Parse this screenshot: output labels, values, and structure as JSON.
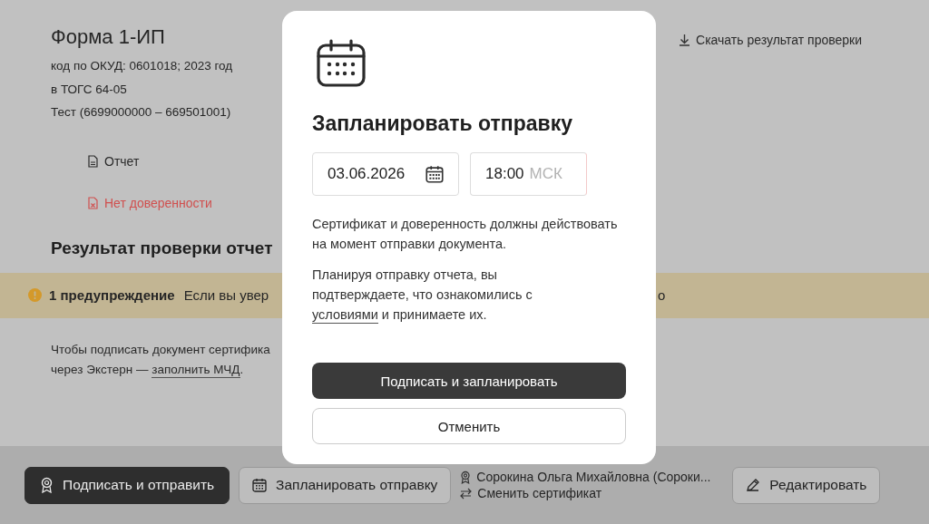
{
  "form": {
    "title": "Форма 1-ИП",
    "details": [
      "код по ОКУД: 0601018; 2023 год",
      "в ТОГС 64-05",
      "Тест (6699000000 – 669501001)"
    ]
  },
  "download_link": "Скачать результат проверки",
  "documents": [
    {
      "label": "Отчет",
      "error": false
    },
    {
      "label": "Нет доверенности",
      "error": true
    }
  ],
  "result": {
    "heading": "Результат проверки отчет",
    "warning": {
      "title": "1 предупреждение",
      "text": "Если вы увер",
      "text_after_dialog": "о"
    },
    "note": "Чтобы подписать документ сертифика",
    "note_line_2": "через Экстерн — ",
    "note_link": "заполнить МЧД",
    "note_end": "."
  },
  "dialog": {
    "title": "Запланировать отправку",
    "date": "03.06.2026",
    "time": "18:00",
    "timezone": "МСК",
    "paragraph_1": "Сертификат и доверенность должны действовать на момент отправки документа.",
    "paragraph_2_before": "Планируя отправку отчета, вы подтверждаете, что ознакомились с ",
    "paragraph_2_link": "условиями",
    "paragraph_2_after": " и принимаете их.",
    "primary_button": "Подписать и запланировать",
    "cancel_button": "Отменить"
  },
  "action_bar": {
    "sign_button": "Подписать и отправить",
    "schedule_button": "Запланировать отправку",
    "certificate_owner": "Сорокина Ольга Михайловна (Сороки...",
    "change_certificate": "Сменить сертификат",
    "edit_button": "Редактировать"
  }
}
